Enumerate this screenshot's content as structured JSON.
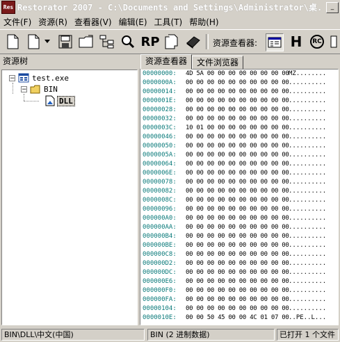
{
  "window": {
    "app_icon_text": "Res",
    "title": "Restorator 2007 - C:\\Documents and Settings\\Administrator\\桌..."
  },
  "menu": [
    {
      "label": "文件(F)"
    },
    {
      "label": "资源(R)"
    },
    {
      "label": "查看器(V)"
    },
    {
      "label": "编辑(E)"
    },
    {
      "label": "工具(T)"
    },
    {
      "label": "帮助(H)"
    }
  ],
  "toolbar": {
    "viewer_label": "资源查看器:",
    "buttons": [
      "new-file",
      "open-dropdown",
      "save",
      "open-folder",
      "resource-tree",
      "find",
      "rp",
      "copy-pages",
      "bookmark",
      "hex-view",
      "h-view",
      "rc-view"
    ],
    "rp_text": "RP",
    "h_text": "H",
    "rc_text": "RC"
  },
  "left_panel": {
    "title": "资源树",
    "tree": {
      "root": "test.exe",
      "folder": "BIN",
      "leaf": "DLL"
    }
  },
  "tabs": [
    {
      "label": "资源查看器",
      "active": true
    },
    {
      "label": "文件浏览器",
      "active": false
    }
  ],
  "hex": [
    {
      "addr": "00000000:",
      "bytes": "4D 5A 00 00 00 00 00 00 00 00",
      "ascii": "MZ........"
    },
    {
      "addr": "0000000A:",
      "bytes": "00 00 00 00 00 00 00 00 00 00",
      "ascii": ".........."
    },
    {
      "addr": "00000014:",
      "bytes": "00 00 00 00 00 00 00 00 00 00",
      "ascii": ".........."
    },
    {
      "addr": "0000001E:",
      "bytes": "00 00 00 00 00 00 00 00 00 00",
      "ascii": ".........."
    },
    {
      "addr": "00000028:",
      "bytes": "00 00 00 00 00 00 00 00 00 00",
      "ascii": ".........."
    },
    {
      "addr": "00000032:",
      "bytes": "00 00 00 00 00 00 00 00 00 00",
      "ascii": ".........."
    },
    {
      "addr": "0000003C:",
      "bytes": "10 01 00 00 00 00 00 00 00 00",
      "ascii": ".........."
    },
    {
      "addr": "00000046:",
      "bytes": "00 00 00 00 00 00 00 00 00 00",
      "ascii": ".........."
    },
    {
      "addr": "00000050:",
      "bytes": "00 00 00 00 00 00 00 00 00 00",
      "ascii": ".........."
    },
    {
      "addr": "0000005A:",
      "bytes": "00 00 00 00 00 00 00 00 00 00",
      "ascii": ".........."
    },
    {
      "addr": "00000064:",
      "bytes": "00 00 00 00 00 00 00 00 00 00",
      "ascii": ".........."
    },
    {
      "addr": "0000006E:",
      "bytes": "00 00 00 00 00 00 00 00 00 00",
      "ascii": ".........."
    },
    {
      "addr": "00000078:",
      "bytes": "00 00 00 00 00 00 00 00 00 00",
      "ascii": ".........."
    },
    {
      "addr": "00000082:",
      "bytes": "00 00 00 00 00 00 00 00 00 00",
      "ascii": ".........."
    },
    {
      "addr": "0000008C:",
      "bytes": "00 00 00 00 00 00 00 00 00 00",
      "ascii": ".........."
    },
    {
      "addr": "00000096:",
      "bytes": "00 00 00 00 00 00 00 00 00 00",
      "ascii": ".........."
    },
    {
      "addr": "000000A0:",
      "bytes": "00 00 00 00 00 00 00 00 00 00",
      "ascii": ".........."
    },
    {
      "addr": "000000AA:",
      "bytes": "00 00 00 00 00 00 00 00 00 00",
      "ascii": ".........."
    },
    {
      "addr": "000000B4:",
      "bytes": "00 00 00 00 00 00 00 00 00 00",
      "ascii": ".........."
    },
    {
      "addr": "000000BE:",
      "bytes": "00 00 00 00 00 00 00 00 00 00",
      "ascii": ".........."
    },
    {
      "addr": "000000C8:",
      "bytes": "00 00 00 00 00 00 00 00 00 00",
      "ascii": ".........."
    },
    {
      "addr": "000000D2:",
      "bytes": "00 00 00 00 00 00 00 00 00 00",
      "ascii": ".........."
    },
    {
      "addr": "000000DC:",
      "bytes": "00 00 00 00 00 00 00 00 00 00",
      "ascii": ".........."
    },
    {
      "addr": "000000E6:",
      "bytes": "00 00 00 00 00 00 00 00 00 00",
      "ascii": ".........."
    },
    {
      "addr": "000000F0:",
      "bytes": "00 00 00 00 00 00 00 00 00 00",
      "ascii": ".........."
    },
    {
      "addr": "000000FA:",
      "bytes": "00 00 00 00 00 00 00 00 00 00",
      "ascii": ".........."
    },
    {
      "addr": "00000104:",
      "bytes": "00 00 00 00 00 00 00 00 00 00",
      "ascii": ".........."
    },
    {
      "addr": "0000010E:",
      "bytes": "00 00 50 45 00 00 4C 01 07 00",
      "ascii": "..PE..L..."
    }
  ],
  "status": {
    "path": "BIN\\DLL\\中文(中国)",
    "type": "BIN (2 进制数据)",
    "opened": "已打开 1 个文件"
  },
  "colors": {
    "face": "#d4d0c8",
    "address": "#0a7a7a",
    "folder": "#f0d060",
    "app_icon": "#7a1a1a"
  }
}
